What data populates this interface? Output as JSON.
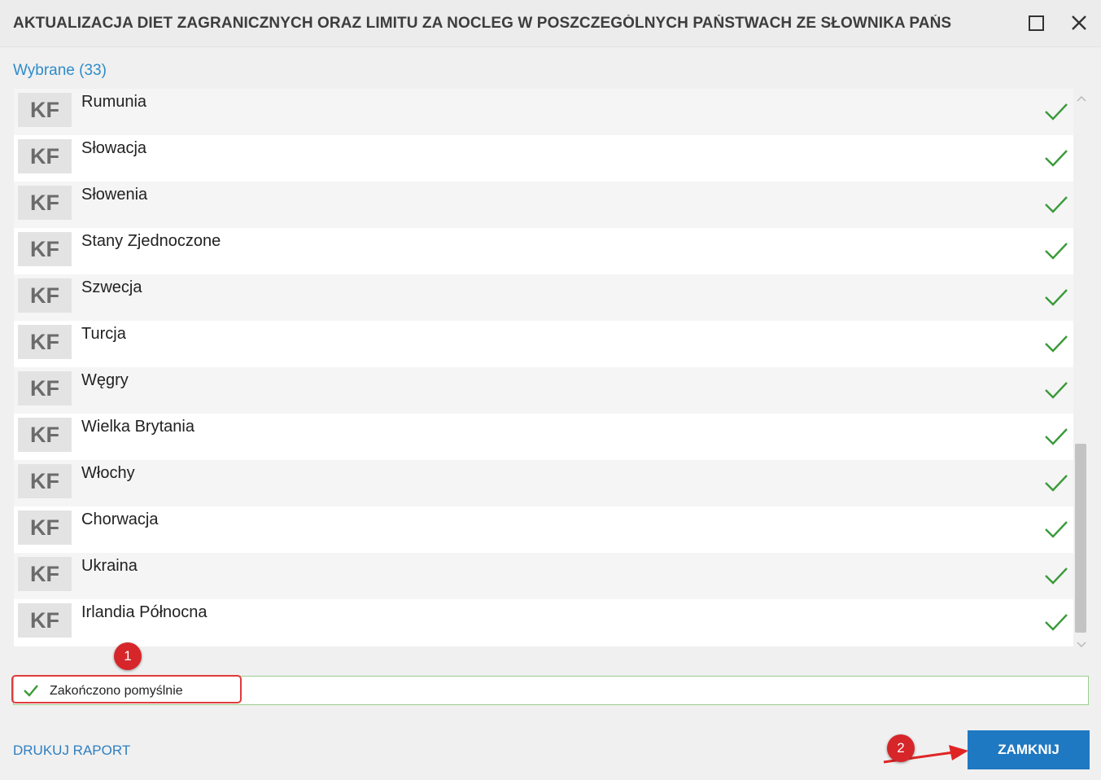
{
  "window": {
    "title": "AKTUALIZACJA DIET ZAGRANICZNYCH ORAZ LIMITU ZA NOCLEG W POSZCZEGÓLNYCH PAŃSTWACH ZE SŁOWNIKA PAŃS"
  },
  "selected": {
    "label": "Wybrane",
    "count": "(33)"
  },
  "list": {
    "items": [
      {
        "badge": "KF",
        "name": "Rumunia"
      },
      {
        "badge": "KF",
        "name": "Słowacja"
      },
      {
        "badge": "KF",
        "name": "Słowenia"
      },
      {
        "badge": "KF",
        "name": "Stany Zjednoczone"
      },
      {
        "badge": "KF",
        "name": "Szwecja"
      },
      {
        "badge": "KF",
        "name": "Turcja"
      },
      {
        "badge": "KF",
        "name": "Węgry"
      },
      {
        "badge": "KF",
        "name": "Wielka Brytania"
      },
      {
        "badge": "KF",
        "name": "Włochy"
      },
      {
        "badge": "KF",
        "name": "Chorwacja"
      },
      {
        "badge": "KF",
        "name": "Ukraina"
      },
      {
        "badge": "KF",
        "name": "Irlandia Północna"
      }
    ]
  },
  "status": {
    "text": "Zakończono pomyślnie"
  },
  "annotations": {
    "badge1": "1",
    "badge2": "2"
  },
  "footer": {
    "print_label": "DRUKUJ RAPORT",
    "close_label": "ZAMKNIJ"
  },
  "colors": {
    "accent": "#1f78c2",
    "link": "#2e8bc9",
    "success": "#3a9a3a",
    "annotation": "#d6262a"
  }
}
